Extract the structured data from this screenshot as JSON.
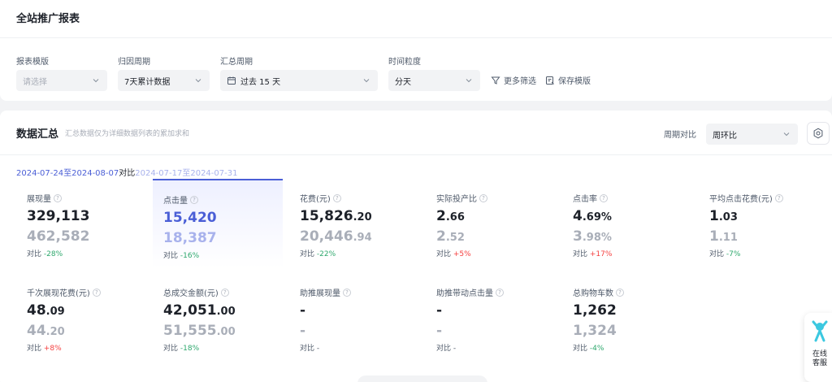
{
  "page_title": "全站推广报表",
  "filters": {
    "template": {
      "label": "报表模版",
      "placeholder": "请选择"
    },
    "attribution": {
      "label": "归因周期",
      "value": "7天累计数据"
    },
    "summary_period": {
      "label": "汇总周期",
      "value": "过去 15 天"
    },
    "granularity": {
      "label": "时间粒度",
      "value": "分天"
    },
    "more_filters": "更多筛选",
    "save_template": "保存模版"
  },
  "summary": {
    "title": "数据汇总",
    "subtitle": "汇总数据仅为详细数据列表的累加求和",
    "compare_label": "周期对比",
    "compare_value": "周环比",
    "date_current": "2024-07-24至2024-08-07",
    "date_vs": "对比",
    "date_previous": "2024-07-17至2024-07-31",
    "metrics": [
      {
        "label": "展现量",
        "value_int": "329,113",
        "value_dec": "",
        "prev_int": "462,582",
        "prev_dec": "",
        "cmp_label": "对比",
        "change": "-28%",
        "dir": "down"
      },
      {
        "label": "点击量",
        "value_int": "15,420",
        "value_dec": "",
        "prev_int": "18,387",
        "prev_dec": "",
        "cmp_label": "对比",
        "change": "-16%",
        "dir": "down"
      },
      {
        "label": "花费(元)",
        "value_int": "15,826",
        "value_dec": ".20",
        "prev_int": "20,446",
        "prev_dec": ".94",
        "cmp_label": "对比",
        "change": "-22%",
        "dir": "down"
      },
      {
        "label": "实际投产比",
        "value_int": "2",
        "value_dec": ".66",
        "prev_int": "2",
        "prev_dec": ".52",
        "cmp_label": "对比",
        "change": "+5%",
        "dir": "up"
      },
      {
        "label": "点击率",
        "value_int": "4",
        "value_dec": ".69%",
        "prev_int": "3",
        "prev_dec": ".98%",
        "cmp_label": "对比",
        "change": "+17%",
        "dir": "up"
      },
      {
        "label": "平均点击花费(元)",
        "value_int": "1",
        "value_dec": ".03",
        "prev_int": "1",
        "prev_dec": ".11",
        "cmp_label": "对比",
        "change": "-7%",
        "dir": "down"
      },
      {
        "label": "千次展现花费(元)",
        "value_int": "48",
        "value_dec": ".09",
        "prev_int": "44",
        "prev_dec": ".20",
        "cmp_label": "对比",
        "change": "+8%",
        "dir": "up"
      },
      {
        "label": "总成交金额(元)",
        "value_int": "42,051",
        "value_dec": ".00",
        "prev_int": "51,555",
        "prev_dec": ".00",
        "cmp_label": "对比",
        "change": "-18%",
        "dir": "down"
      },
      {
        "label": "助推展现量",
        "value_int": "-",
        "value_dec": "",
        "prev_int": "-",
        "prev_dec": "",
        "cmp_label": "对比",
        "change": "-",
        "dir": "none"
      },
      {
        "label": "助推带动点击量",
        "value_int": "-",
        "value_dec": "",
        "prev_int": "-",
        "prev_dec": "",
        "cmp_label": "对比",
        "change": "-",
        "dir": "none"
      },
      {
        "label": "总购物车数",
        "value_int": "1,262",
        "value_dec": "",
        "prev_int": "1,324",
        "prev_dec": "",
        "cmp_label": "对比",
        "change": "-4%",
        "dir": "down"
      }
    ]
  },
  "customer_service": "在线客服",
  "colors": {
    "accent": "#4a5ed6",
    "down": "#2ea86d",
    "up": "#f53f3f"
  }
}
